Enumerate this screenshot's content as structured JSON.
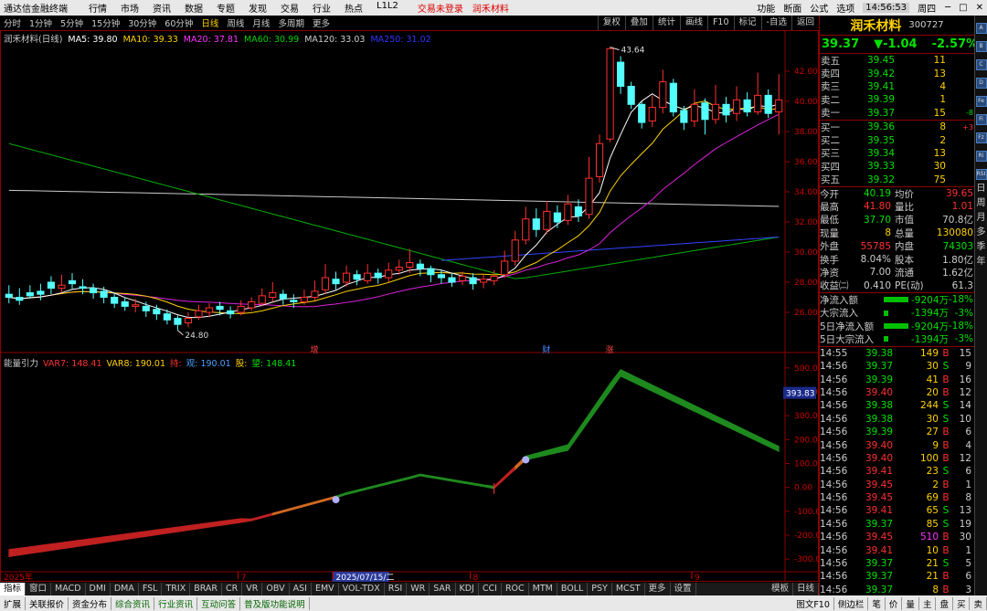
{
  "app": {
    "title": "通达信金融终端"
  },
  "topmenu": [
    "行情",
    "市场",
    "资讯",
    "数据",
    "专题",
    "发现",
    "交易",
    "行业",
    "热点",
    "L1L2"
  ],
  "login_alert": "交易未登录",
  "stock_tag": "润禾材料",
  "top_right": [
    "功能",
    "断面",
    "公式",
    "选项"
  ],
  "clock": "14:56:53",
  "weekday": "周四",
  "periods": [
    "分时",
    "1分钟",
    "5分钟",
    "15分钟",
    "30分钟",
    "60分钟",
    "日线",
    "周线",
    "月线",
    "多周期",
    "更多"
  ],
  "active_period": "日线",
  "right_tools": [
    "复权",
    "叠加",
    "统计",
    "画线",
    "F10",
    "标记",
    "-自选",
    "返回"
  ],
  "ma": {
    "title": "润禾材料(日线)",
    "items": [
      {
        "label": "MA5: 39.80",
        "color": "#ffffff"
      },
      {
        "label": "MA10: 39.33",
        "color": "#ffd200"
      },
      {
        "label": "MA20: 37.81",
        "color": "#ff33ff"
      },
      {
        "label": "MA60: 30.99",
        "color": "#00d000"
      },
      {
        "label": "MA120: 33.03",
        "color": "#cccccc"
      },
      {
        "label": "MA250: 31.02",
        "color": "#3333ff"
      }
    ]
  },
  "price_axis": [
    "42.00",
    "40.00",
    "38.00",
    "36.00",
    "34.00",
    "32.00",
    "30.00",
    "28.00",
    "26.00"
  ],
  "hi_label": "43.64",
  "lo_label": "24.80",
  "event_markers": [
    {
      "label": "增",
      "color": "#ff4444"
    },
    {
      "label": "财",
      "color": "#4488ff"
    },
    {
      "label": "涨",
      "color": "#ff4444"
    }
  ],
  "sub": {
    "title": "能量引力",
    "items": [
      {
        "label": "VAR7: 148.41",
        "color": "#ff3030"
      },
      {
        "label": "VAR8: 190.01",
        "color": "#ffd200"
      },
      {
        "label": "持:",
        "color": "#ff3030"
      },
      {
        "label": "观: 190.01",
        "color": "#4aa0ff"
      },
      {
        "label": "股:",
        "color": "#ffd200"
      },
      {
        "label": "望: 148.41",
        "color": "#00e000"
      }
    ],
    "axis": [
      "500.0",
      "400.0",
      "300.0",
      "200.0",
      "100.0",
      "0.00",
      "-100.0",
      "-200.0",
      "-300.0"
    ],
    "current": "393.83"
  },
  "x_labels": [
    "2025年",
    "7",
    "2025/07/15/二",
    "8",
    "9"
  ],
  "chart_data": {
    "type": "candlestick",
    "title": "润禾材料(日线)",
    "ylim": [
      24,
      44
    ],
    "candles": [
      [
        27.2,
        27.0,
        27.8,
        26.6
      ],
      [
        27.0,
        26.8,
        27.6,
        26.5
      ],
      [
        27.3,
        27.1,
        27.8,
        26.9
      ],
      [
        27.4,
        27.2,
        27.9,
        26.8
      ],
      [
        28.0,
        27.6,
        28.4,
        27.2
      ],
      [
        27.6,
        27.8,
        28.5,
        27.3
      ],
      [
        28.1,
        27.9,
        28.6,
        27.5
      ],
      [
        27.7,
        27.6,
        28.2,
        27.2
      ],
      [
        27.6,
        27.3,
        27.9,
        26.9
      ],
      [
        27.4,
        27.0,
        27.7,
        26.6
      ],
      [
        27.0,
        26.6,
        27.3,
        26.3
      ],
      [
        26.7,
        26.4,
        27.0,
        26.1
      ],
      [
        26.4,
        26.5,
        26.9,
        26.0
      ],
      [
        26.4,
        26.1,
        26.7,
        25.7
      ],
      [
        26.2,
        25.9,
        26.5,
        25.5
      ],
      [
        25.9,
        25.5,
        26.2,
        25.2
      ],
      [
        25.6,
        25.2,
        25.8,
        24.8
      ],
      [
        25.3,
        25.6,
        26.0,
        25.0
      ],
      [
        25.7,
        26.1,
        26.5,
        25.5
      ],
      [
        26.0,
        26.3,
        26.6,
        25.7
      ],
      [
        26.4,
        26.2,
        26.7,
        25.8
      ],
      [
        26.1,
        25.9,
        26.4,
        25.6
      ],
      [
        26.0,
        26.4,
        26.8,
        25.8
      ],
      [
        26.3,
        26.7,
        27.0,
        26.1
      ],
      [
        26.6,
        27.1,
        27.6,
        26.4
      ],
      [
        27.0,
        27.3,
        28.0,
        26.7
      ],
      [
        27.2,
        26.9,
        27.5,
        26.5
      ],
      [
        26.8,
        26.7,
        27.2,
        26.3
      ],
      [
        26.7,
        27.0,
        27.5,
        26.5
      ],
      [
        27.0,
        27.4,
        28.1,
        26.8
      ],
      [
        27.5,
        28.3,
        29.2,
        27.2
      ],
      [
        28.2,
        27.9,
        28.7,
        27.5
      ],
      [
        28.0,
        28.6,
        29.1,
        27.7
      ],
      [
        28.5,
        28.2,
        28.8,
        27.8
      ],
      [
        28.1,
        28.6,
        29.2,
        27.9
      ],
      [
        28.6,
        28.3,
        28.9,
        27.9
      ],
      [
        28.3,
        28.8,
        29.3,
        28.0
      ],
      [
        28.8,
        29.0,
        29.5,
        28.5
      ],
      [
        29.0,
        29.3,
        30.2,
        28.6
      ],
      [
        29.2,
        28.9,
        29.5,
        28.4
      ],
      [
        28.9,
        28.5,
        29.1,
        28.0
      ],
      [
        28.5,
        28.3,
        28.8,
        27.9
      ],
      [
        28.3,
        28.0,
        28.6,
        27.7
      ],
      [
        28.1,
        28.4,
        28.7,
        27.8
      ],
      [
        28.3,
        27.9,
        28.6,
        27.5
      ],
      [
        28.0,
        28.2,
        28.5,
        27.6
      ],
      [
        28.1,
        28.4,
        28.8,
        27.8
      ],
      [
        28.5,
        29.4,
        30.1,
        28.3
      ],
      [
        29.4,
        30.8,
        31.4,
        29.1
      ],
      [
        30.8,
        32.2,
        33.0,
        30.5
      ],
      [
        32.2,
        31.5,
        32.9,
        31.0
      ],
      [
        31.5,
        32.7,
        33.4,
        31.2
      ],
      [
        32.6,
        32.0,
        33.1,
        31.6
      ],
      [
        32.1,
        33.2,
        33.8,
        31.8
      ],
      [
        33.0,
        32.4,
        33.5,
        32.0
      ],
      [
        32.5,
        34.9,
        36.3,
        32.2
      ],
      [
        35.0,
        37.2,
        37.8,
        34.6
      ],
      [
        37.5,
        43.5,
        43.6,
        37.3
      ],
      [
        42.6,
        41.0,
        43.0,
        40.5
      ],
      [
        41.0,
        39.8,
        41.3,
        39.5
      ],
      [
        39.8,
        38.6,
        40.0,
        38.2
      ],
      [
        38.7,
        39.6,
        40.4,
        38.3
      ],
      [
        39.6,
        41.3,
        42.1,
        39.2
      ],
      [
        41.2,
        39.3,
        41.5,
        39.0
      ],
      [
        39.4,
        38.6,
        39.7,
        38.1
      ],
      [
        38.7,
        39.8,
        40.8,
        38.3
      ],
      [
        39.9,
        38.8,
        40.2,
        37.8
      ],
      [
        38.8,
        39.8,
        41.1,
        38.5
      ],
      [
        39.8,
        39.1,
        40.3,
        38.6
      ],
      [
        39.2,
        40.1,
        41.0,
        38.7
      ],
      [
        40.1,
        39.3,
        40.6,
        39.0
      ],
      [
        39.3,
        40.4,
        41.9,
        39.1
      ],
      [
        40.4,
        39.2,
        40.8,
        38.9
      ],
      [
        39.3,
        40.1,
        41.8,
        37.8
      ]
    ],
    "sub_series": {
      "name": "能量引力",
      "ylim": [
        -330,
        530
      ]
    }
  },
  "rp": {
    "name": "润禾材料",
    "code": "300727",
    "quote": [
      "39.37",
      "▼-1.04",
      "-2.57%"
    ],
    "asks": [
      {
        "label": "卖五",
        "price": "39.45",
        "vol": "11",
        "chg": ""
      },
      {
        "label": "卖四",
        "price": "39.42",
        "vol": "13",
        "chg": ""
      },
      {
        "label": "卖三",
        "price": "39.41",
        "vol": "4",
        "chg": ""
      },
      {
        "label": "卖二",
        "price": "39.39",
        "vol": "1",
        "chg": ""
      },
      {
        "label": "卖一",
        "price": "39.37",
        "vol": "15",
        "chg": "-8"
      }
    ],
    "bids": [
      {
        "label": "买一",
        "price": "39.36",
        "vol": "8",
        "chg": "+3"
      },
      {
        "label": "买二",
        "price": "39.35",
        "vol": "2",
        "chg": ""
      },
      {
        "label": "买三",
        "price": "39.34",
        "vol": "13",
        "chg": ""
      },
      {
        "label": "买四",
        "price": "39.33",
        "vol": "30",
        "chg": ""
      },
      {
        "label": "买五",
        "price": "39.32",
        "vol": "75",
        "chg": ""
      }
    ],
    "stats": [
      {
        "k": "今开",
        "v": "40.19",
        "vc": "#00e000",
        "k2": "均价",
        "v2": "39.65",
        "v2c": "#ff3030"
      },
      {
        "k": "最高",
        "v": "41.80",
        "vc": "#ff3030",
        "k2": "量比",
        "v2": "1.01",
        "v2c": "#ff3030"
      },
      {
        "k": "最低",
        "v": "37.70",
        "vc": "#00e000",
        "k2": "市值",
        "v2": "70.8亿",
        "v2c": "#ccc"
      },
      {
        "k": "现量",
        "v": "8",
        "vc": "#ffd200",
        "k2": "总量",
        "v2": "130080",
        "v2c": "#ffd200"
      },
      {
        "k": "外盘",
        "v": "55785",
        "vc": "#ff3030",
        "k2": "内盘",
        "v2": "74303",
        "v2c": "#00e000"
      },
      {
        "k": "换手",
        "v": "8.04%",
        "vc": "#ccc",
        "k2": "股本",
        "v2": "1.80亿",
        "v2c": "#ccc"
      },
      {
        "k": "净资",
        "v": "7.00",
        "vc": "#ccc",
        "k2": "流通",
        "v2": "1.62亿",
        "v2c": "#ccc"
      },
      {
        "k": "收益㈡",
        "v": "0.410",
        "vc": "#ccc",
        "k2": "PE(动)",
        "v2": "61.3",
        "v2c": "#ccc"
      }
    ],
    "flows": [
      {
        "k": "净流入额",
        "v": "-9204万",
        "p": "-18%",
        "bar": 0.9
      },
      {
        "k": "大宗流入",
        "v": "-1394万",
        "p": "-3%",
        "bar": 0.15
      },
      {
        "k": "5日净流入额",
        "v": "-9204万",
        "p": "-18%",
        "bar": 0.9
      },
      {
        "k": "5日大宗流入",
        "v": "-1394万",
        "p": "-3%",
        "bar": 0.15
      }
    ],
    "ticks": [
      {
        "t": "14:55",
        "p": "39.38",
        "v": "149",
        "f": "B",
        "n": "15"
      },
      {
        "t": "14:56",
        "p": "39.37",
        "v": "30",
        "f": "S",
        "n": "9"
      },
      {
        "t": "14:56",
        "p": "39.39",
        "v": "41",
        "f": "B",
        "n": "16"
      },
      {
        "t": "14:56",
        "p": "39.40",
        "v": "20",
        "f": "B",
        "n": "12"
      },
      {
        "t": "14:56",
        "p": "39.38",
        "v": "244",
        "f": "S",
        "n": "14"
      },
      {
        "t": "14:56",
        "p": "39.38",
        "v": "30",
        "f": "S",
        "n": "10"
      },
      {
        "t": "14:56",
        "p": "39.39",
        "v": "27",
        "f": "B",
        "n": "6"
      },
      {
        "t": "14:56",
        "p": "39.40",
        "v": "9",
        "f": "B",
        "n": "4"
      },
      {
        "t": "14:56",
        "p": "39.40",
        "v": "100",
        "f": "B",
        "n": "12"
      },
      {
        "t": "14:56",
        "p": "39.41",
        "v": "23",
        "f": "S",
        "n": "6"
      },
      {
        "t": "14:56",
        "p": "39.45",
        "v": "2",
        "f": "B",
        "n": "1"
      },
      {
        "t": "14:56",
        "p": "39.45",
        "v": "69",
        "f": "B",
        "n": "8"
      },
      {
        "t": "14:56",
        "p": "39.41",
        "v": "65",
        "f": "S",
        "n": "13"
      },
      {
        "t": "14:56",
        "p": "39.37",
        "v": "85",
        "f": "S",
        "n": "19"
      },
      {
        "t": "14:56",
        "p": "39.45",
        "v": "510",
        "f": "B",
        "n": "30"
      },
      {
        "t": "14:56",
        "p": "39.41",
        "v": "10",
        "f": "B",
        "n": "1"
      },
      {
        "t": "14:56",
        "p": "39.37",
        "v": "21",
        "f": "S",
        "n": "5"
      },
      {
        "t": "14:56",
        "p": "39.37",
        "v": "21",
        "f": "B",
        "n": "6"
      },
      {
        "t": "14:56",
        "p": "39.37",
        "v": "8",
        "f": "B",
        "n": "3"
      }
    ]
  },
  "bottom_tabs": [
    "指标",
    "窗口",
    "MACD",
    "DMI",
    "DMA",
    "FSL",
    "TRIX",
    "BRAR",
    "CR",
    "VR",
    "OBV",
    "ASI",
    "EMV",
    "VOL-TDX",
    "RSI",
    "WR",
    "SAR",
    "KDJ",
    "CCI",
    "ROC",
    "MTM",
    "BOLL",
    "PSY",
    "MCST",
    "更多",
    "设置"
  ],
  "bottom_right": [
    "模板",
    "日线"
  ],
  "status": [
    "扩展",
    "关联报价",
    "资金分布",
    "综合资讯",
    "行业资讯",
    "互动问答",
    "普及版功能说明"
  ],
  "status_right": [
    "图文F10",
    "侧边栏",
    "笔",
    "价",
    "量",
    "主",
    "盘",
    "买",
    "卖"
  ],
  "side_icons": [
    "A",
    "B",
    "C",
    "D",
    "Fe",
    "Fi",
    "Fz",
    "Ri",
    "RSI"
  ],
  "side_text": [
    "日",
    "周",
    "月",
    "多",
    "季",
    "年"
  ]
}
